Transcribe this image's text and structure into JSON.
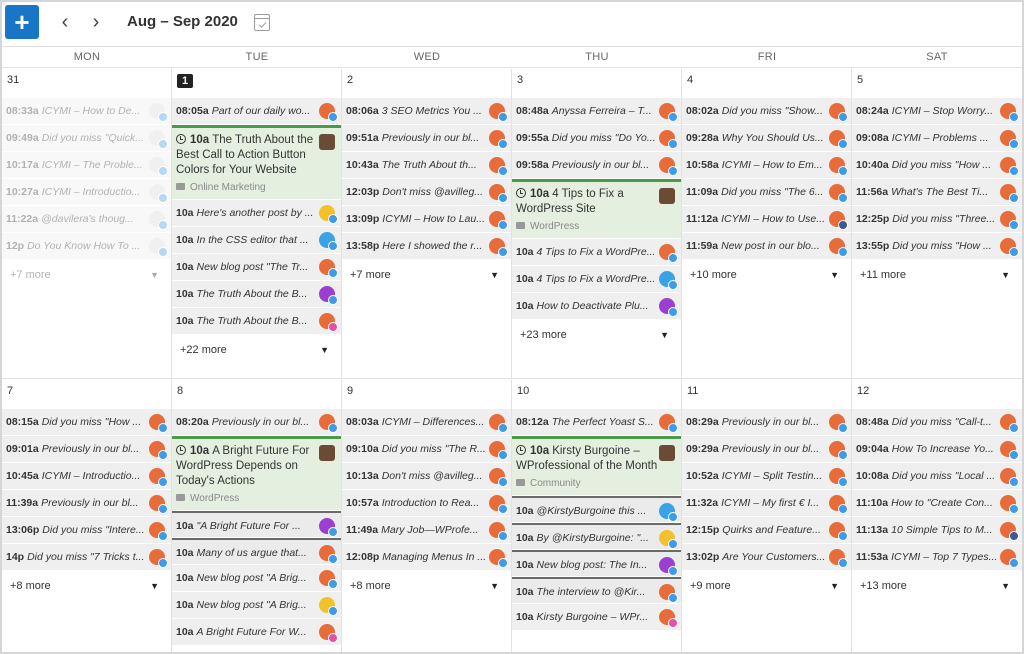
{
  "toolbar": {
    "add_label": "+",
    "prev_label": "‹",
    "next_label": "›",
    "range": "Aug – Sep 2020"
  },
  "weekdays": [
    "MON",
    "TUE",
    "WED",
    "THU",
    "FRI",
    "SAT"
  ],
  "week1": {
    "mon": {
      "num": "31",
      "posts": [
        {
          "time": "08:33a",
          "text": "ICYMI – How to De..."
        },
        {
          "time": "09:49a",
          "text": "Did you miss \"Quick..."
        },
        {
          "time": "10:17a",
          "text": "ICYMI – The Proble..."
        },
        {
          "time": "10:27a",
          "text": "ICYMI – Introductio..."
        },
        {
          "time": "11:22a",
          "text": "@davilera's thoug..."
        },
        {
          "time": "12p",
          "text": "Do You Know How To ..."
        }
      ],
      "more": "+7 more"
    },
    "tue": {
      "num": "1",
      "post_a": {
        "time": "08:05a",
        "text": "Part of our daily wo..."
      },
      "feature": {
        "time": "10a",
        "title": "The Truth About the Best Call to Action Button Colors for Your Website",
        "category": "Online Marketing"
      },
      "posts": [
        {
          "time": "10a",
          "text": "Here's another post by ..."
        },
        {
          "time": "10a",
          "text": "In the CSS editor that ..."
        },
        {
          "time": "10a",
          "text": "New blog post \"The Tr..."
        },
        {
          "time": "10a",
          "text": "The Truth About the B..."
        },
        {
          "time": "10a",
          "text": "The Truth About the B..."
        }
      ],
      "more": "+22 more"
    },
    "wed": {
      "num": "2",
      "posts": [
        {
          "time": "08:06a",
          "text": "3 SEO Metrics You ..."
        },
        {
          "time": "09:51a",
          "text": "Previously in our bl..."
        },
        {
          "time": "10:43a",
          "text": "The Truth About th..."
        },
        {
          "time": "12:03p",
          "text": "Don't miss @avilleg..."
        },
        {
          "time": "13:09p",
          "text": "ICYMI – How to Lau..."
        },
        {
          "time": "13:58p",
          "text": "Here I showed the r..."
        }
      ],
      "more": "+7 more"
    },
    "thu": {
      "num": "3",
      "posts_a": [
        {
          "time": "08:48a",
          "text": "Anyssa Ferreira – T..."
        },
        {
          "time": "09:55a",
          "text": "Did you miss \"Do Yo..."
        },
        {
          "time": "09:58a",
          "text": "Previously in our bl..."
        }
      ],
      "feature": {
        "time": "10a",
        "title": "4 Tips to Fix a WordPress Site",
        "category": "WordPress"
      },
      "posts_b": [
        {
          "time": "10a",
          "text": "4 Tips to Fix a WordPre..."
        },
        {
          "time": "10a",
          "text": "4 Tips to Fix a WordPre..."
        },
        {
          "time": "10a",
          "text": "How to Deactivate Plu..."
        }
      ],
      "more": "+23 more"
    },
    "fri": {
      "num": "4",
      "posts": [
        {
          "time": "08:02a",
          "text": "Did you miss \"Show..."
        },
        {
          "time": "09:28a",
          "text": "Why You Should Us..."
        },
        {
          "time": "10:58a",
          "text": "ICYMI – How to Em..."
        },
        {
          "time": "11:09a",
          "text": "Did you miss \"The 6..."
        },
        {
          "time": "11:12a",
          "text": "ICYMI – How to Use..."
        },
        {
          "time": "11:59a",
          "text": "New post in our blo..."
        }
      ],
      "more": "+10 more"
    },
    "sat": {
      "num": "5",
      "posts": [
        {
          "time": "08:24a",
          "text": "ICYMI – Stop Worry..."
        },
        {
          "time": "09:08a",
          "text": "ICYMI – Problems ..."
        },
        {
          "time": "10:40a",
          "text": "Did you miss \"How ..."
        },
        {
          "time": "11:56a",
          "text": "What's The Best Ti..."
        },
        {
          "time": "12:25p",
          "text": "Did you miss \"Three..."
        },
        {
          "time": "13:55p",
          "text": "Did you miss \"How ..."
        }
      ],
      "more": "+11 more"
    }
  },
  "week2": {
    "mon": {
      "num": "7",
      "posts": [
        {
          "time": "08:15a",
          "text": "Did you miss \"How ..."
        },
        {
          "time": "09:01a",
          "text": "Previously in our bl..."
        },
        {
          "time": "10:45a",
          "text": "ICYMI – Introductio..."
        },
        {
          "time": "11:39a",
          "text": "Previously in our bl..."
        },
        {
          "time": "13:06p",
          "text": "Did you miss \"Intere..."
        },
        {
          "time": "14p",
          "text": "Did you miss \"7 Tricks t..."
        }
      ],
      "more": "+8 more"
    },
    "tue": {
      "num": "8",
      "post_a": {
        "time": "08:20a",
        "text": "Previously in our bl..."
      },
      "feature": {
        "time": "10a",
        "title": "A Bright Future For WordPress Depends on Today's Actions",
        "category": "WordPress"
      },
      "posts": [
        {
          "time": "10a",
          "text": "\"A Bright Future For ..."
        },
        {
          "time": "10a",
          "text": "Many of us argue that..."
        },
        {
          "time": "10a",
          "text": "New blog post \"A Brig..."
        },
        {
          "time": "10a",
          "text": "New blog post \"A Brig..."
        },
        {
          "time": "10a",
          "text": "A Bright Future For W..."
        }
      ]
    },
    "wed": {
      "num": "9",
      "posts": [
        {
          "time": "08:03a",
          "text": "ICYMI – Differences..."
        },
        {
          "time": "09:10a",
          "text": "Did you miss \"The R..."
        },
        {
          "time": "10:13a",
          "text": "Don't miss @avilleg..."
        },
        {
          "time": "10:57a",
          "text": "Introduction to Rea..."
        },
        {
          "time": "11:49a",
          "text": "Mary Job—WProfe..."
        },
        {
          "time": "12:08p",
          "text": "Managing Menus In ..."
        }
      ],
      "more": "+8 more"
    },
    "thu": {
      "num": "10",
      "post_a": {
        "time": "08:12a",
        "text": "The Perfect Yoast S..."
      },
      "feature": {
        "time": "10a",
        "title": "Kirsty Burgoine – WProfessional of the Month",
        "category": "Community"
      },
      "posts": [
        {
          "time": "10a",
          "text": "@KirstyBurgoine this ..."
        },
        {
          "time": "10a",
          "text": "By @KirstyBurgoine: \"..."
        },
        {
          "time": "10a",
          "text": "New blog post: The In..."
        },
        {
          "time": "10a",
          "text": "The interview to @Kir..."
        },
        {
          "time": "10a",
          "text": "Kirsty Burgoine – WPr..."
        }
      ]
    },
    "fri": {
      "num": "11",
      "posts": [
        {
          "time": "08:29a",
          "text": "Previously in our bl..."
        },
        {
          "time": "09:29a",
          "text": "Previously in our bl..."
        },
        {
          "time": "10:52a",
          "text": "ICYMI – Split Testin..."
        },
        {
          "time": "11:32a",
          "text": "ICYMI – My first € I..."
        },
        {
          "time": "12:15p",
          "text": "Quirks and Feature..."
        },
        {
          "time": "13:02p",
          "text": "Are Your Customers..."
        }
      ],
      "more": "+9 more"
    },
    "sat": {
      "num": "12",
      "posts": [
        {
          "time": "08:48a",
          "text": "Did you miss \"Call-t..."
        },
        {
          "time": "09:04a",
          "text": "How To Increase Yo..."
        },
        {
          "time": "10:08a",
          "text": "Did you miss \"Local ..."
        },
        {
          "time": "11:10a",
          "text": "How to \"Create Con..."
        },
        {
          "time": "11:13a",
          "text": "10 Simple Tips to M..."
        },
        {
          "time": "11:53a",
          "text": "ICYMI – Top 7 Types..."
        }
      ],
      "more": "+13 more"
    }
  },
  "colors": {
    "accent": "#1976c7",
    "feature_green": "#4a9a4a",
    "feature_bg": "#e5efdf"
  }
}
